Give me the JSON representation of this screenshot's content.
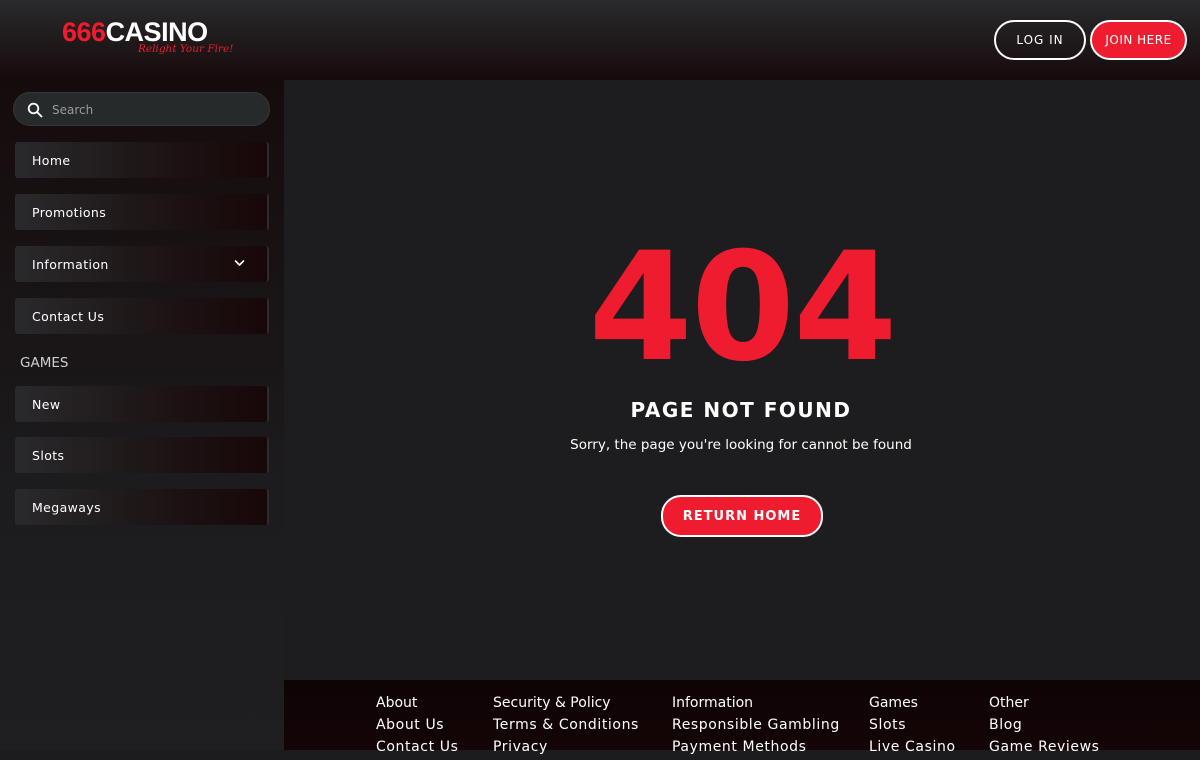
{
  "header": {
    "logo": {
      "number": "666",
      "word": "CASINO",
      "tagline": "Relight Your Fire!"
    },
    "login_label": "LOG IN",
    "join_label": "JOIN HERE"
  },
  "sidebar": {
    "search": {
      "placeholder": "Search",
      "value": ""
    },
    "items": [
      {
        "label": "Home"
      },
      {
        "label": "Promotions"
      },
      {
        "label": "Information",
        "icon": "chevron-down-icon"
      },
      {
        "label": "Contact Us"
      }
    ],
    "games_heading": "GAMES",
    "games": [
      {
        "label": "New"
      },
      {
        "label": "Slots"
      },
      {
        "label": "Megaways"
      }
    ]
  },
  "main": {
    "error_code": "404",
    "title": "PAGE NOT FOUND",
    "message": "Sorry, the page you're looking for cannot be found",
    "return_label": "RETURN HOME"
  },
  "footer": {
    "columns": [
      {
        "heading": "About",
        "links": [
          "About Us",
          "Contact Us"
        ]
      },
      {
        "heading": "Security & Policy",
        "links": [
          "Terms & Conditions",
          "Privacy"
        ]
      },
      {
        "heading": "Information",
        "links": [
          "Responsible Gambling",
          "Payment Methods"
        ]
      },
      {
        "heading": "Games",
        "links": [
          "Slots",
          "Live Casino"
        ]
      },
      {
        "heading": "Other",
        "links": [
          "Blog",
          "Game Reviews"
        ]
      }
    ]
  },
  "colors": {
    "accent": "#ee1c2e",
    "background": "#1d1c1e",
    "header": "#160a0b"
  }
}
